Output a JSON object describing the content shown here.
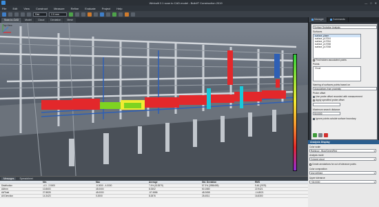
{
  "window": {
    "title": "Winbuilt 2.1 scan to CAD.model - BuildIT Construction 2019",
    "minimize": "—",
    "maximize": "□",
    "close": "✕"
  },
  "menu": [
    "File",
    "Edit",
    "View",
    "Construct",
    "Measure",
    "Refine",
    "Evaluate",
    "Project",
    "Help"
  ],
  "toolbar": {
    "combo_1": "Dist",
    "combo_2": "2.5 mm"
  },
  "tabs": [
    "Scan-to-CAD",
    "Model",
    "Cloud",
    "Deviation",
    "Mesh"
  ],
  "viewport": {
    "label": "Top View"
  },
  "right_panel": {
    "tabs": [
      "Manager",
      "Commands"
    ],
    "title": "Surface Deviation Analysis",
    "surfaces_label": "Surfaces",
    "surfaces": [
      "surface_plane",
      "surface_p17004",
      "surface_p17054",
      "surface_p17058",
      "surface_p17058"
    ],
    "find_hidden_label": "Find hidden associated points",
    "points_label": "Points",
    "points_value": "Cloud",
    "naming_label": "Naming of surfaces points based on",
    "naming_value": "Associations from proximity",
    "probe_offset_label": "Probe offset",
    "option_1": "Use probe offset recorded with measurement",
    "option_2": "Apply specified probe offset",
    "max_dist_label": "Maximum search distance",
    "max_dist_value": "50.0000",
    "ignore_label": "Ignore points outside surface boundary"
  },
  "analysis": {
    "header": "Analysis Display",
    "color_scale_label": "Color scale",
    "color_scale_value": "Rainbow - Blue/Green/Red",
    "analysis_mode_label": "Analysis mode",
    "analysis_mode_value": "Colored cloud",
    "annotation_label": "Create annotations for out of tolerance points",
    "color_comp_label": "Color composition",
    "color_comp_value": "Use defined",
    "upper_tol_label": "Upper tolerance",
    "upper_tol_value": "+30.0000"
  },
  "statistics": {
    "tabs": [
      "Messages",
      "Spreadsheet"
    ],
    "headers": [
      "",
      "Min",
      "Max",
      "Average",
      "Std. Deviation",
      "RMS"
    ],
    "rows": [
      [
        "Distribution",
        "-4.0 - 2.5000",
        "-5.0000 - 4.0000",
        "7.4% (513579)",
        "57.3% (3958459)",
        "5.46 (2578)"
      ],
      [
        "All/mm",
        "10.8603",
        "45.0000",
        "8.3302",
        "50.1580",
        "22.9421"
      ],
      [
        "All/Total",
        "27.8828",
        "45.0000",
        "-57.4586",
        "48.2658",
        "-14.8021"
      ],
      [
        "All Direction",
        "14.3423",
        "0.2000",
        "8.2876",
        "28.4511",
        "16.8300"
      ]
    ]
  },
  "colors": {
    "accent": "#3f7fc9",
    "deviation_red": "#e3282b",
    "deviation_green": "#7ed321",
    "deviation_yellow": "#f2ec32"
  }
}
